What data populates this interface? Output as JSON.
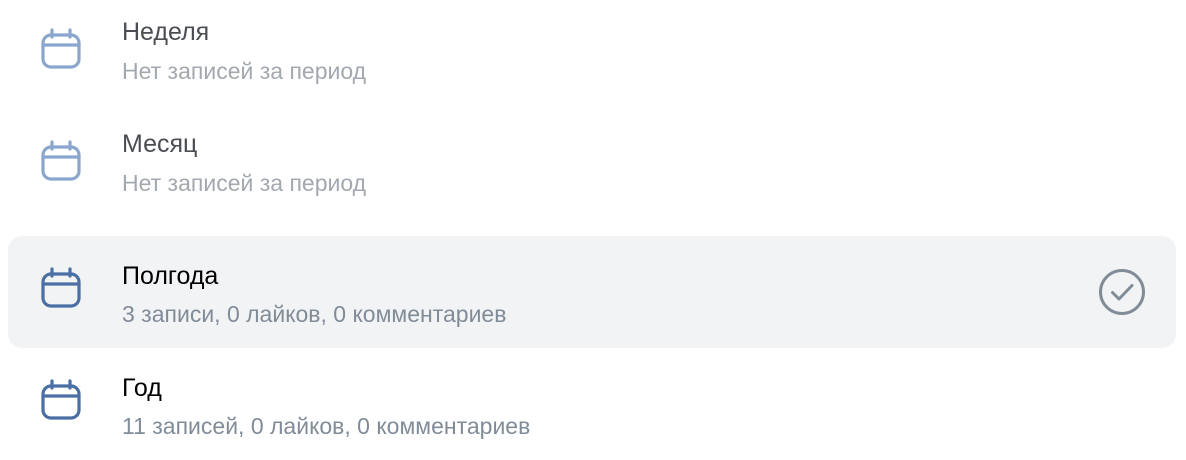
{
  "colors": {
    "icon_dim": "#8ba6cc",
    "icon_active": "#4a6fa5",
    "selected_bg": "#f2f3f5",
    "check": "#818c99"
  },
  "periods": [
    {
      "icon": "calendar-icon",
      "title": "Неделя",
      "subtitle": "Нет записей за период",
      "selected": false
    },
    {
      "icon": "calendar-icon",
      "title": "Месяц",
      "subtitle": "Нет записей за период",
      "selected": false
    },
    {
      "icon": "calendar-icon",
      "title": "Полгода",
      "subtitle": "3 записи, 0 лайков, 0 комментариев",
      "selected": true,
      "selected_icon": "check-circle-icon"
    },
    {
      "icon": "calendar-icon",
      "title": "Год",
      "subtitle": "11 записей, 0 лайков, 0 комментариев",
      "selected": false
    }
  ]
}
